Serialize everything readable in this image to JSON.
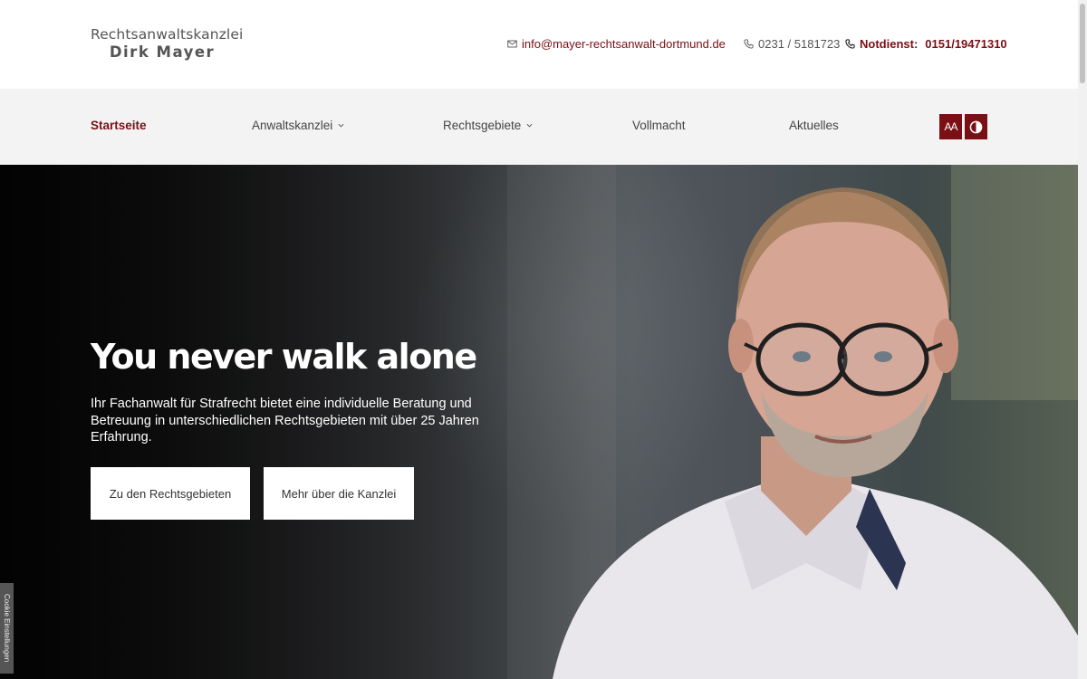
{
  "brand": {
    "line1": "Rechtsanwaltskanzlei",
    "line2": "Dirk Mayer"
  },
  "contact": {
    "email": "info@mayer-rechtsanwalt-dortmund.de",
    "phone": "0231 / 5181723",
    "emergency_label": "Notdienst:",
    "emergency_phone": "0151/19471310"
  },
  "nav": {
    "items": [
      {
        "label": "Startseite",
        "active": true
      },
      {
        "label": "Anwaltskanzlei",
        "dropdown": true
      },
      {
        "label": "Rechtsgebiete",
        "dropdown": true
      },
      {
        "label": "Vollmacht"
      },
      {
        "label": "Aktuelles"
      }
    ],
    "font_size_button": "AA",
    "contrast_button_icon": "contrast-icon"
  },
  "hero": {
    "title": "You never walk alone",
    "text": "Ihr Fachanwalt für Strafrecht bietet eine individuelle Beratung und Betreuung in unterschiedlichen Rechtsgebieten mit über 25 Jahren Erfahrung.",
    "button1": "Zu den Rechtsgebieten",
    "button2": "Mehr über die Kanzlei"
  },
  "cookie_tab": "Cookie Einstellungen",
  "colors": {
    "accent": "#7a0f16",
    "nav_bg": "#f3f3f3"
  }
}
